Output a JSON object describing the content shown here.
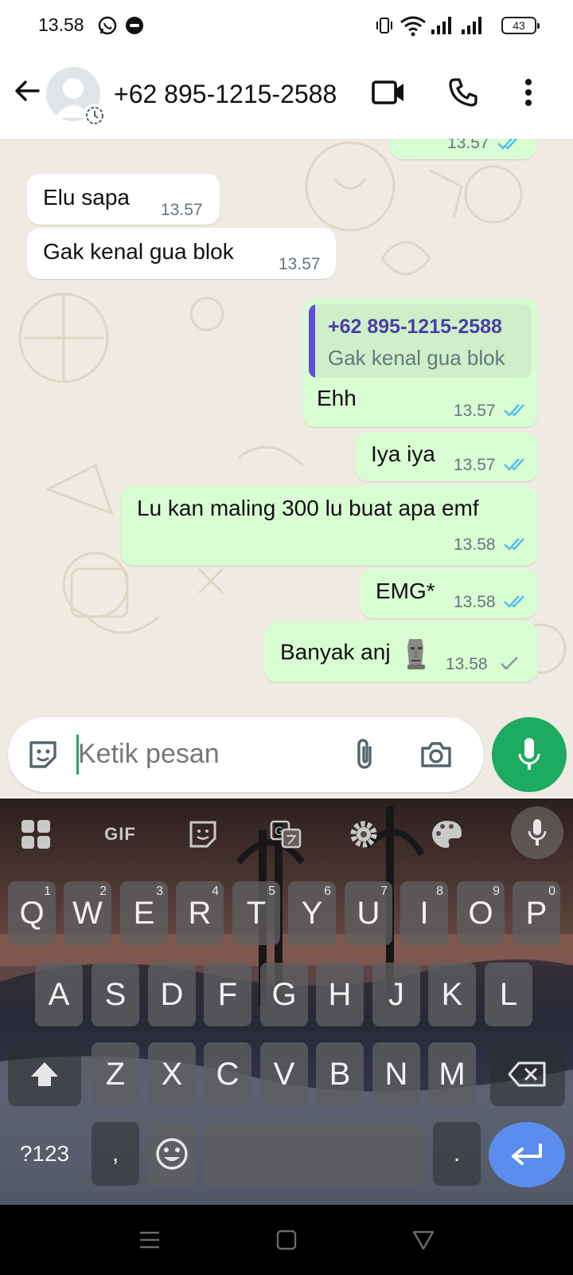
{
  "status_bar": {
    "time": "13.58",
    "battery": "43"
  },
  "header": {
    "contact": "+62 895-1215-2588"
  },
  "messages": [
    {
      "dir": "out",
      "text": "",
      "time": "13.57",
      "status": "read"
    },
    {
      "dir": "in",
      "text": "Elu sapa",
      "time": "13.57"
    },
    {
      "dir": "in",
      "text": "Gak kenal gua blok",
      "time": "13.57"
    },
    {
      "dir": "out",
      "quote_name": "+62 895-1215-2588",
      "quote_text": "Gak kenal gua blok",
      "text": "Ehh",
      "time": "13.57",
      "status": "read"
    },
    {
      "dir": "out",
      "text": "Iya iya",
      "time": "13.57",
      "status": "read"
    },
    {
      "dir": "out",
      "text": "Lu kan maling 300 lu buat apa emf",
      "time": "13.58",
      "status": "read"
    },
    {
      "dir": "out",
      "text": "EMG*",
      "time": "13.58",
      "status": "read"
    },
    {
      "dir": "out",
      "text": "Banyak anj",
      "emoji": "moai-icon",
      "time": "13.58",
      "status": "sent"
    }
  ],
  "composer": {
    "placeholder": "Ketik pesan"
  },
  "keyboard": {
    "toolbar": [
      "apps-icon",
      "GIF",
      "sticker-icon",
      "translate-icon",
      "settings-icon",
      "palette-icon",
      "mic-icon"
    ],
    "gif_label": "GIF",
    "row1": [
      {
        "k": "Q",
        "n": "1"
      },
      {
        "k": "W",
        "n": "2"
      },
      {
        "k": "E",
        "n": "3"
      },
      {
        "k": "R",
        "n": "4"
      },
      {
        "k": "T",
        "n": "5"
      },
      {
        "k": "Y",
        "n": "6"
      },
      {
        "k": "U",
        "n": "7"
      },
      {
        "k": "I",
        "n": "8"
      },
      {
        "k": "O",
        "n": "9"
      },
      {
        "k": "P",
        "n": "0"
      }
    ],
    "row2": [
      "A",
      "S",
      "D",
      "F",
      "G",
      "H",
      "J",
      "K",
      "L"
    ],
    "row3": [
      "Z",
      "X",
      "C",
      "V",
      "B",
      "N",
      "M"
    ],
    "symbols_label": "?123",
    "comma": ",",
    "period": "."
  },
  "colors": {
    "wa_green": "#1daa61",
    "out_bubble": "#d9fdd3",
    "in_bubble": "#ffffff",
    "read_tick": "#53bdeb",
    "chat_bg": "#efeae2"
  }
}
